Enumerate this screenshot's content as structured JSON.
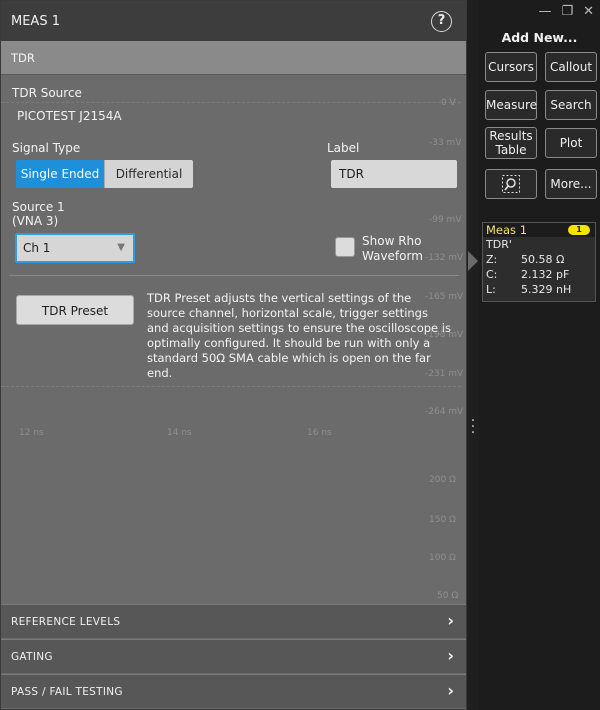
{
  "panel": {
    "title": "MEAS 1",
    "help_icon": "help-icon",
    "section": "TDR",
    "tdr_source_label": "TDR Source",
    "tdr_source_value": "PICOTEST J2154A",
    "signal_type_label": "Signal Type",
    "signal_type_options": [
      "Single Ended",
      "Differential"
    ],
    "signal_type_selected": "Single Ended",
    "label_label": "Label",
    "label_value": "TDR",
    "source1_label_line1": "Source 1",
    "source1_label_line2": "(VNA 3)",
    "source1_value": "Ch 1",
    "show_rho_line1": "Show Rho",
    "show_rho_line2": "Waveform",
    "show_rho_checked": false,
    "tdr_preset_button": "TDR Preset",
    "tdr_preset_description": "TDR Preset adjusts the vertical settings of the source channel, horizontal scale, trigger settings and acquisition settings to ensure the oscilloscope is optimally configured. It should be run with only a standard 50Ω SMA cable which is open on the far end."
  },
  "background_readouts": [
    "0 V",
    "-33 mV",
    "-99 mV",
    "-132 mV",
    "-165 mV",
    "-198 mV",
    "-231 mV",
    "-264 mV",
    "200 Ω",
    "150 Ω",
    "100 Ω",
    "50 Ω",
    "12 ns",
    "14 ns",
    "16 ns"
  ],
  "accordions": [
    {
      "label": "REFERENCE LEVELS"
    },
    {
      "label": "GATING"
    },
    {
      "label": "PASS / FAIL TESTING"
    }
  ],
  "right_panel": {
    "add_new_title": "Add New...",
    "buttons": {
      "cursors": "Cursors",
      "callout": "Callout",
      "measure": "Measure",
      "search": "Search",
      "results_table_line1": "Results",
      "results_table_line2": "Table",
      "plot": "Plot",
      "zoom_icon": "zoom-select-icon",
      "more": "More..."
    },
    "meas_badge": {
      "title": "Meas 1",
      "number": "1",
      "source": "TDR'",
      "rows": [
        {
          "key": "Z:",
          "value": "50.58 Ω"
        },
        {
          "key": "C:",
          "value": "2.132 pF"
        },
        {
          "key": "L:",
          "value": "5.329 nH"
        }
      ]
    }
  },
  "colors": {
    "accent": "#1e8fd8",
    "badge_yellow": "#f5e400",
    "panel_bg": "#6b6b6b"
  }
}
